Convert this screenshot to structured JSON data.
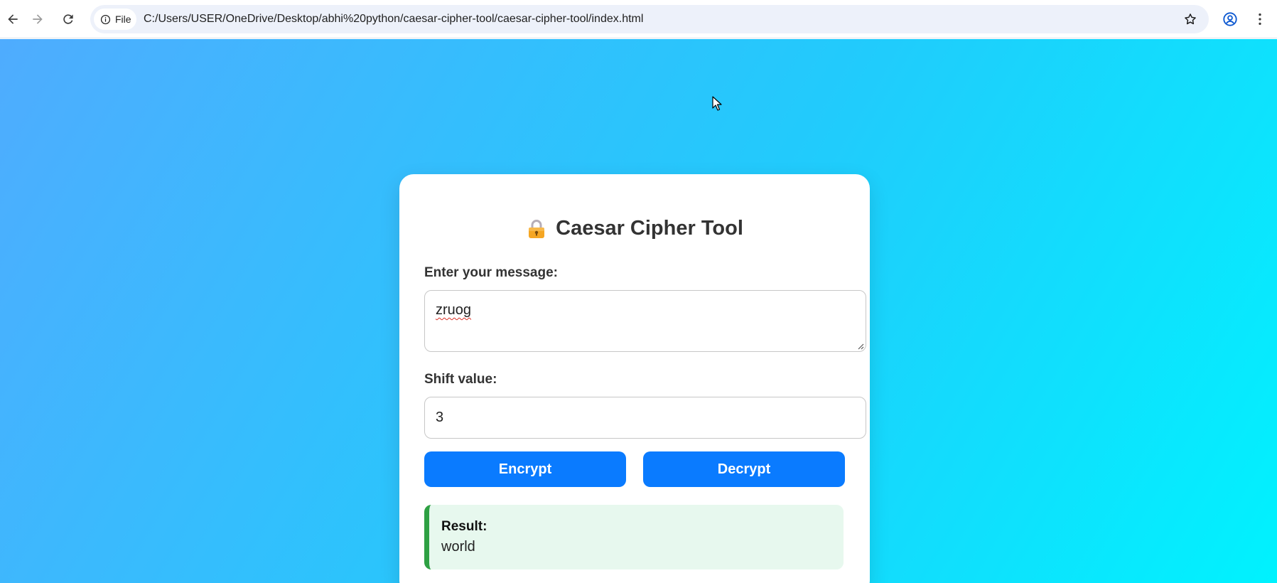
{
  "browser": {
    "site_chip_label": "File",
    "url": "C:/Users/USER/OneDrive/Desktop/abhi%20python/caesar-cipher-tool/caesar-cipher-tool/index.html",
    "icons": [
      "back-arrow-icon",
      "forward-arrow-icon",
      "reload-icon",
      "info-icon",
      "star-icon",
      "profile-icon",
      "more-vert-icon"
    ]
  },
  "card": {
    "title": "Caesar Cipher Tool",
    "title_icon": "lock-icon",
    "message_label": "Enter your message:",
    "message_value": "zruog",
    "shift_label": "Shift value:",
    "shift_value": "3",
    "encrypt_label": "Encrypt",
    "decrypt_label": "Decrypt",
    "result_label": "Result:",
    "result_value": "world"
  },
  "colors": {
    "gradient_start": "#4facfe",
    "gradient_end": "#00f2fe",
    "button": "#0a7bff",
    "result_bg": "#e7f8ee",
    "result_border": "#2ea043"
  }
}
